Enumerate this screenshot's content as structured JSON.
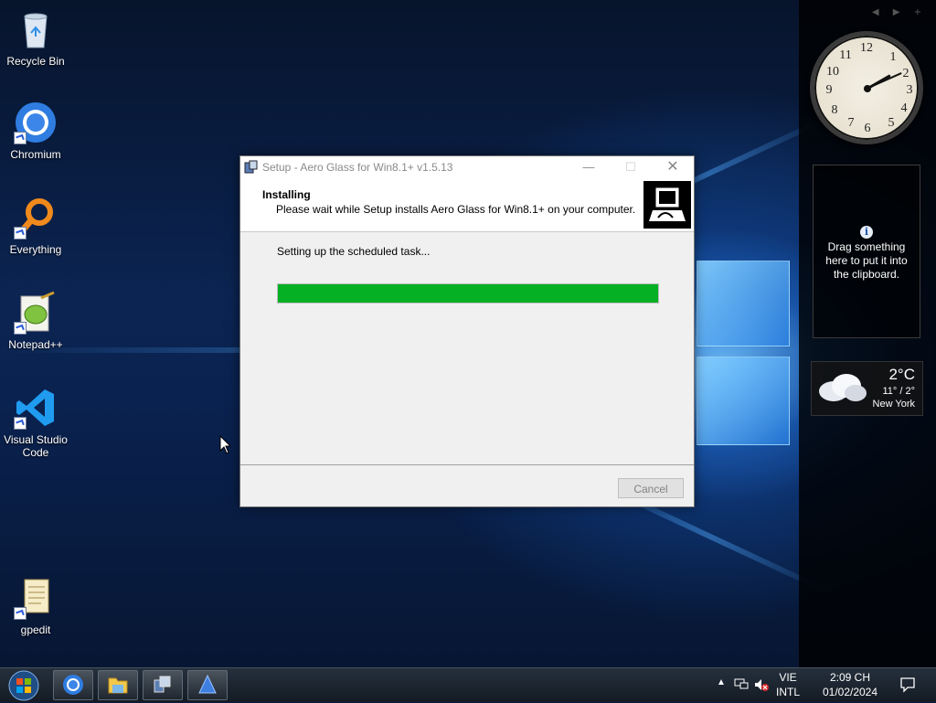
{
  "desktop_icons": [
    {
      "label": "Recycle Bin",
      "icon": "recycle-bin-icon"
    },
    {
      "label": "Chromium",
      "icon": "chromium-icon"
    },
    {
      "label": "Everything",
      "icon": "everything-search-icon"
    },
    {
      "label": "Notepad++",
      "icon": "notepad-plus-plus-icon"
    },
    {
      "label": "Visual Studio\nCode",
      "icon": "vscode-icon"
    },
    {
      "label": "gpedit",
      "icon": "gpedit-icon"
    }
  ],
  "sidebar": {
    "clip_gadget": {
      "text": "Drag something here to put it into the clipboard."
    },
    "weather": {
      "temp": "2°C",
      "range": "11° / 2°",
      "city": "New York"
    }
  },
  "dialog": {
    "title": "Setup - Aero Glass for Win8.1+ v1.5.13",
    "header_title": "Installing",
    "header_subtitle": "Please wait while Setup installs Aero Glass for Win8.1+ on your computer.",
    "status": "Setting up the scheduled task...",
    "progress_fraction": 1.0,
    "cancel_label": "Cancel"
  },
  "taskbar": {
    "items": [
      "chromium-taskbar-icon",
      "file-explorer-taskbar-icon",
      "setup-taskbar-icon",
      "aero-glass-taskbar-icon"
    ],
    "lang_top": "VIE",
    "lang_bottom": "INTL",
    "time": "2:09 CH",
    "date": "01/02/2024"
  },
  "colors": {
    "progress": "#06b025",
    "accent": "#1e6fd9"
  }
}
